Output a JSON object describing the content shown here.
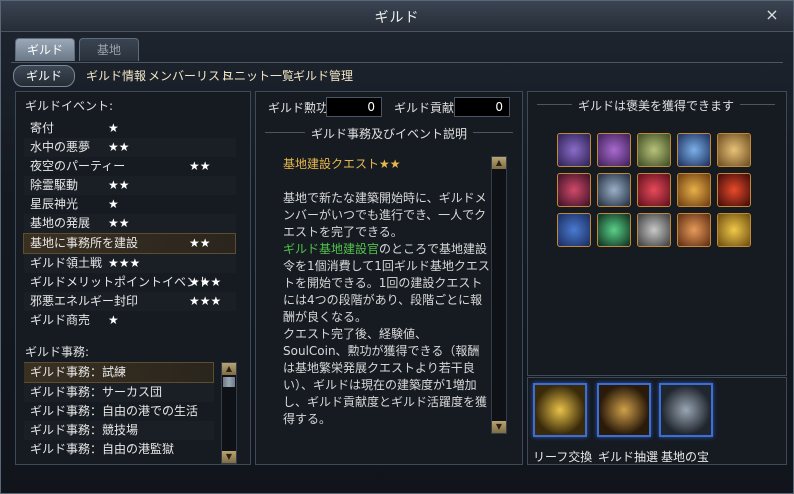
{
  "window": {
    "title": "ギルド",
    "close_glyph": "×"
  },
  "tabs": [
    {
      "label": "ギルド"
    },
    {
      "label": "基地"
    }
  ],
  "subnav": {
    "button": "ギルド",
    "links": [
      "ギルド情報",
      "メンバーリスト",
      "ユニット一覧",
      "ギルド管理"
    ]
  },
  "events": {
    "header": "ギルドイベント:",
    "items": [
      {
        "name": "寄付",
        "stars": "★"
      },
      {
        "name": "水中の悪夢",
        "stars": "★★"
      },
      {
        "name": "夜空のパーティー",
        "stars": "★★"
      },
      {
        "name": "除霊駆動",
        "stars": "★★"
      },
      {
        "name": "星辰神光",
        "stars": "★"
      },
      {
        "name": "基地の発展",
        "stars": "★★"
      },
      {
        "name": "基地に事務所を建設",
        "stars": "★★"
      },
      {
        "name": "ギルド領土戦",
        "stars": "★★★"
      },
      {
        "name": "ギルドメリットポイントイベント",
        "stars": "★★★"
      },
      {
        "name": "邪悪エネルギー封印",
        "stars": "★★★"
      },
      {
        "name": "ギルド商売",
        "stars": "★"
      }
    ]
  },
  "affairs": {
    "header": "ギルド事務:",
    "items": [
      "ギルド事務：試練",
      "ギルド事務：サーカス団",
      "ギルド事務：自由の港での生活",
      "ギルド事務：競技場",
      "ギルド事務：自由の港監獄"
    ]
  },
  "stats": {
    "merit_label": "ギルド勲功",
    "merit_value": "0",
    "contrib_label": "ギルド貢献",
    "contrib_value": "0"
  },
  "description": {
    "title": "ギルド事務及びイベント説明",
    "quest_title": "基地建設クエスト★★",
    "p1": "基地で新たな建築開始時に、ギルドメンバーがいつでも進行でき、一人でクエストを完了できる。",
    "npc": "ギルド基地建設官",
    "p2": "のところで基地建設令を1個消費して1回ギルド基地クエストを開始できる。1回の建設クエストには4つの段階があり、段階ごとに報酬が良くなる。",
    "p3": "クエスト完了後、経験値、SoulCoin、勲功が獲得できる（報酬は基地繁栄発展クエストより若干良い）、ギルドは現在の建築度が1増加し、ギルド貢献度とギルド活躍度を獲得する。"
  },
  "rewards": {
    "title": "ギルドは褒美を獲得できます",
    "icons": [
      "scroll-icon",
      "treasure-chest-icon",
      "map-scroll-icon",
      "crystal-wand-icon",
      "golden-scroll-icon",
      "purple-rune-icon",
      "dragon-icon",
      "red-gem-icon",
      "gold-coin-pouch-icon",
      "red-crystal-icon",
      "blueprint-icon",
      "cocktail-icon",
      "shovel-icon",
      "roasted-meat-icon",
      "gold-ingots-icon"
    ]
  },
  "actions": [
    {
      "label": "リーフ交換",
      "icon": "golden-statue-icon"
    },
    {
      "label": "ギルド抽選",
      "icon": "compass-icon"
    },
    {
      "label": "基地の宝",
      "icon": "silver-chest-icon"
    }
  ],
  "colors": {
    "accent_gold": "#e7b84a",
    "npc_green": "#52c24a",
    "action_border": "#3b6fd4"
  }
}
